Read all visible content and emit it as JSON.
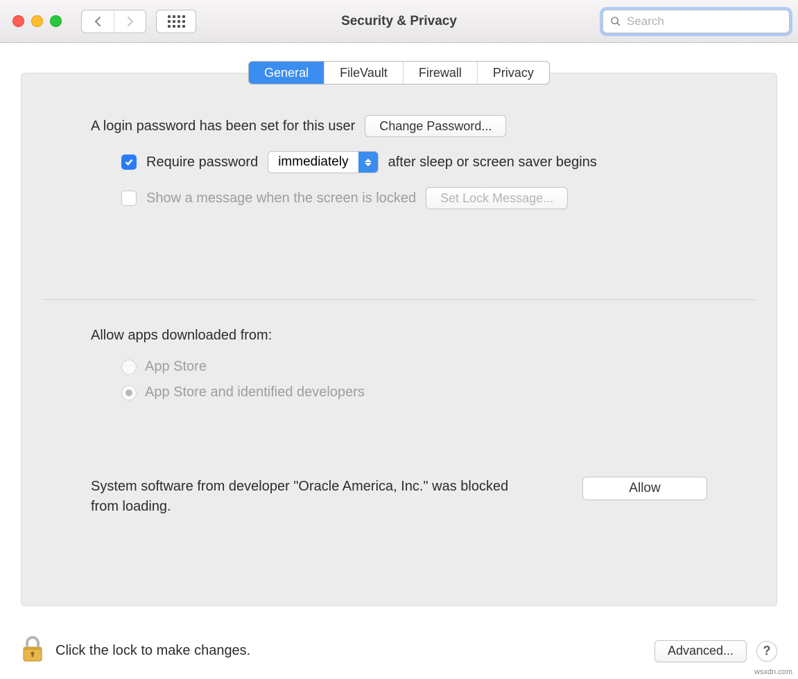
{
  "window": {
    "title": "Security & Privacy"
  },
  "search": {
    "placeholder": "Search",
    "value": ""
  },
  "tabs": {
    "general": "General",
    "filevault": "FileVault",
    "firewall": "Firewall",
    "privacy": "Privacy",
    "active": "general"
  },
  "general": {
    "login_password_set": "A login password has been set for this user",
    "change_password_btn": "Change Password...",
    "require_password_label": "Require password",
    "require_password_delay": "immediately",
    "after_sleep_text": "after sleep or screen saver begins",
    "show_message_label": "Show a message when the screen is locked",
    "set_lock_message_btn": "Set Lock Message...",
    "allow_apps_heading": "Allow apps downloaded from:",
    "radio_app_store": "App Store",
    "radio_app_store_dev": "App Store and identified developers",
    "blocked_software_text": "System software from developer \"Oracle America, Inc.\" was blocked from loading.",
    "allow_btn": "Allow"
  },
  "footer": {
    "lock_text": "Click the lock to make changes.",
    "advanced_btn": "Advanced...",
    "help": "?"
  },
  "watermark": "wsxdn.com"
}
